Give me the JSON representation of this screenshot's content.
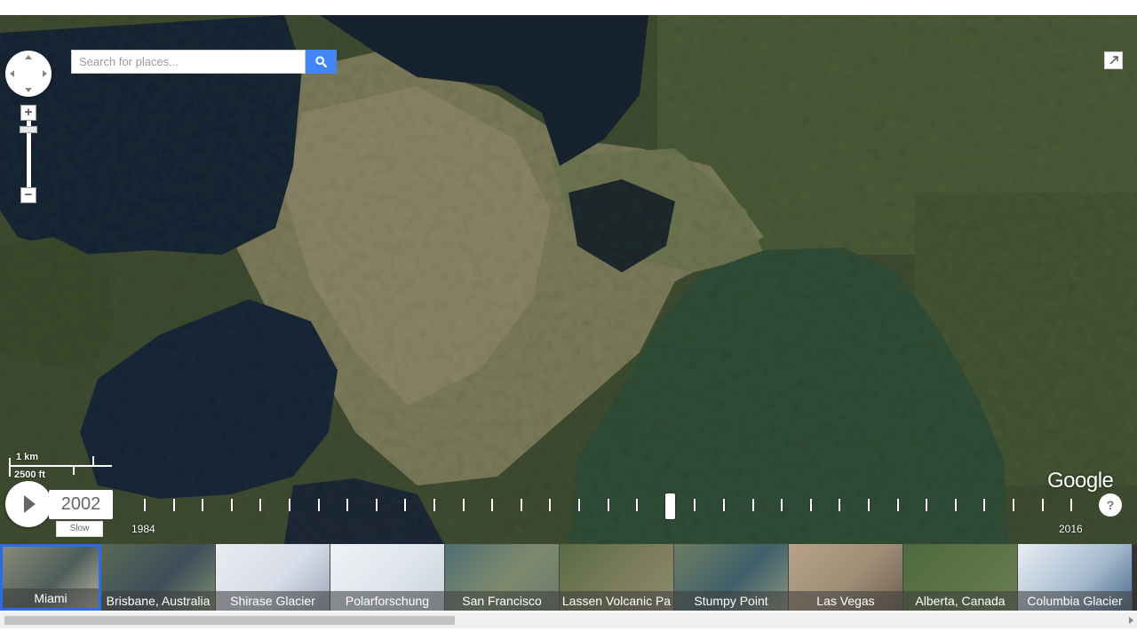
{
  "search": {
    "placeholder": "Search for places..."
  },
  "controls": {
    "zoom_in": "+",
    "zoom_out": "−",
    "help": "?"
  },
  "scale": {
    "metric": "1 km",
    "imperial": "2500 ft"
  },
  "attribution": "Google",
  "timelapse": {
    "current_year": "2002",
    "speed_label": "Slow",
    "start_year": "1984",
    "end_year": "2016",
    "selected_position": 0.5588
  },
  "places": [
    {
      "label": "Miami",
      "selected": true,
      "colors": [
        "#8a8a7a",
        "#4f5e5a",
        "#b9b3a3"
      ]
    },
    {
      "label": "Brisbane, Australia",
      "colors": [
        "#5a6a55",
        "#3d4e5a",
        "#7d8c6e"
      ]
    },
    {
      "label": "Shirase Glacier",
      "colors": [
        "#e8ecf2",
        "#d7dde8",
        "#9aa6b8"
      ]
    },
    {
      "label": "Polarforschung",
      "colors": [
        "#eef2f6",
        "#dfe5ec",
        "#c7d0db"
      ]
    },
    {
      "label": "San Francisco",
      "colors": [
        "#4d6e73",
        "#7f8a6d",
        "#6a7a70"
      ]
    },
    {
      "label": "Lassen Volcanic Pa",
      "colors": [
        "#596b45",
        "#7c7d5a",
        "#8e8a70"
      ]
    },
    {
      "label": "Stumpy Point",
      "colors": [
        "#6d7e63",
        "#3f5f6a",
        "#8b9580"
      ]
    },
    {
      "label": "Las Vegas",
      "colors": [
        "#b7a38a",
        "#9f8d76",
        "#705f52"
      ]
    },
    {
      "label": "Alberta, Canada",
      "colors": [
        "#4f6a3f",
        "#5c7448",
        "#6e7e55"
      ]
    },
    {
      "label": "Columbia Glacier",
      "colors": [
        "#e9eef4",
        "#a8bdd0",
        "#4d6d8f"
      ]
    }
  ],
  "colors": {
    "accent": "#4285f4",
    "selection": "#2b6de8"
  }
}
